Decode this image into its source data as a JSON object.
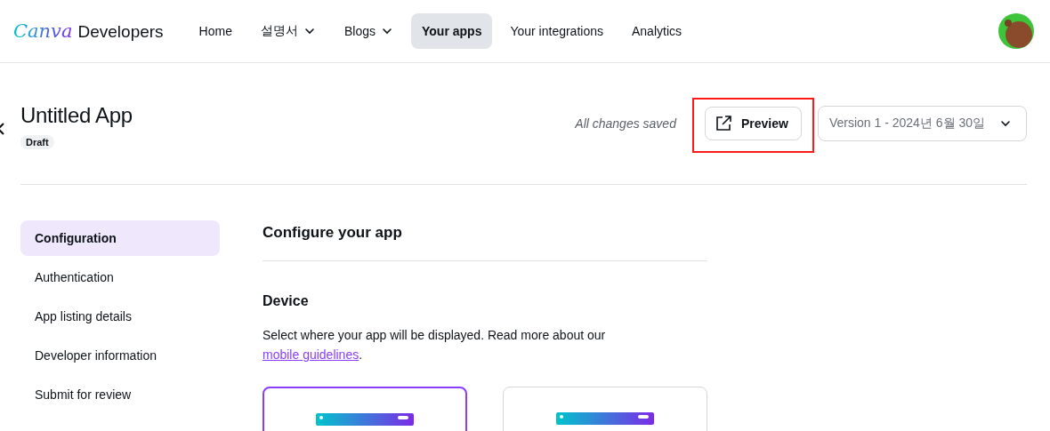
{
  "header": {
    "logo": {
      "script": "Canva",
      "word": "Developers"
    },
    "nav": [
      {
        "label": "Home",
        "dropdown": false,
        "selected": false
      },
      {
        "label": "설명서",
        "dropdown": true,
        "selected": false
      },
      {
        "label": "Blogs",
        "dropdown": true,
        "selected": false
      },
      {
        "label": "Your apps",
        "dropdown": false,
        "selected": true
      },
      {
        "label": "Your integrations",
        "dropdown": false,
        "selected": false
      },
      {
        "label": "Analytics",
        "dropdown": false,
        "selected": false
      }
    ]
  },
  "app": {
    "title": "Untitled App",
    "status": "Draft",
    "save_status": "All changes saved",
    "preview_button": {
      "label": "Preview",
      "highlighted": true
    },
    "version": "Version 1 - 2024년 6월 30일"
  },
  "sidebar": {
    "items": [
      {
        "label": "Configuration",
        "selected": true
      },
      {
        "label": "Authentication",
        "selected": false
      },
      {
        "label": "App listing details",
        "selected": false
      },
      {
        "label": "Developer information",
        "selected": false
      },
      {
        "label": "Submit for review",
        "selected": false
      }
    ]
  },
  "main": {
    "heading": "Configure your app",
    "section": "Device",
    "description": "Select where your app will be displayed. Read more about our ",
    "link": "mobile guidelines",
    "after_link": ".",
    "devices": [
      {
        "selected": true
      },
      {
        "selected": false
      }
    ]
  }
}
